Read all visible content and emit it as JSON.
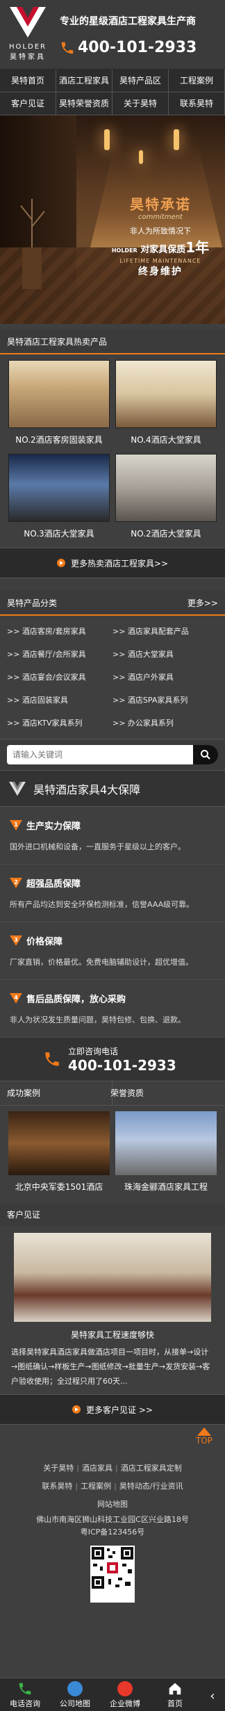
{
  "header": {
    "logo_en": "HOLDER",
    "logo_cn": "昊特家具",
    "slogan": "专业的星级酒店工程家具生产商",
    "hotline": "400-101-2933"
  },
  "nav": [
    "昊特首页",
    "酒店工程家具",
    "昊特产品区",
    "工程案例",
    "客户见证",
    "昊特荣誉资质",
    "关于昊特",
    "联系昊特"
  ],
  "banner": {
    "promise_cn": "昊特承诺",
    "promise_en": "commitment",
    "line1": "非人为所致情况下",
    "line2_pre": "HOLDER",
    "line2_main": "对家具保质",
    "line2_num": "1年",
    "line3": "LIFETIME MAINTENANCE",
    "line4": "终身维护"
  },
  "hot": {
    "title": "昊特酒店工程家具热卖产品",
    "items": [
      "NO.2酒店客房固装家具",
      "NO.4酒店大堂家具",
      "NO.3酒店大堂家具",
      "NO.2酒店大堂家具"
    ],
    "more": "更多热卖酒店工程家具>>"
  },
  "categories": {
    "title": "昊特产品分类",
    "more": "更多>>",
    "items": [
      ">> 酒店客房/套房家具",
      ">> 酒店家具配套产品",
      ">> 酒店餐厅/会所家具",
      ">> 酒店大堂家具",
      ">> 酒店宴会/会议家具",
      ">> 酒店户外家具",
      ">> 酒店固装家具",
      ">> 酒店SPA家具系列",
      ">> 酒店KTV家具系列",
      ">> 办公家具系列"
    ]
  },
  "search": {
    "placeholder": "请输入关键词"
  },
  "guarantee": {
    "title": "昊特酒店家具4大保障",
    "items": [
      {
        "num": "1",
        "head": "生产实力保障",
        "desc": "国外进口机械和设备，一直服务于星级以上的客户。"
      },
      {
        "num": "2",
        "head": "超强品质保障",
        "desc": "所有产品均达到安全环保检测标准，信誉AAA级可靠。"
      },
      {
        "num": "3",
        "head": "价格保障",
        "desc": "厂家直销，价格最优。免费电脑辅助设计，超优增值。"
      },
      {
        "num": "4",
        "head": "售后品质保障，放心采购",
        "desc": "非人为状况发生质量问题，昊特包修、包换、退款。"
      }
    ]
  },
  "consult": {
    "label": "立即咨询电话",
    "phone": "400-101-2933"
  },
  "cases": {
    "tabs": [
      "成功案例",
      "荣誉资质"
    ],
    "items": [
      "北京中央军委1501酒店",
      "珠海金郦酒店家具工程"
    ]
  },
  "review": {
    "title": "客户见证",
    "caption": "昊特家具工程速度够快",
    "text": "选择昊特家具酒店家具做酒店项目一项目时，从接单→设计→图纸确认→样板生产→图纸修改→批量生产→发货安装→客户验收使用；全过程只用了60天...",
    "more": "更多客户见证 >>"
  },
  "top_label": "TOP",
  "footer": {
    "row1": [
      "关于昊特",
      "酒店家具",
      "酒店工程家具定制"
    ],
    "row2": [
      "联系昊特",
      "工程案例",
      "昊特动态/行业资讯"
    ],
    "sitemap": "网站地图",
    "address": "佛山市南海区狮山科技工业园C区兴业路18号",
    "icp": "粤ICP备123456号"
  },
  "bottom_nav": [
    "电话咨询",
    "公司地图",
    "企业微博",
    "首页"
  ],
  "colors": {
    "accent": "#f07a1a",
    "bg": "#3f3f3f",
    "logo_red": "#c8102e"
  }
}
